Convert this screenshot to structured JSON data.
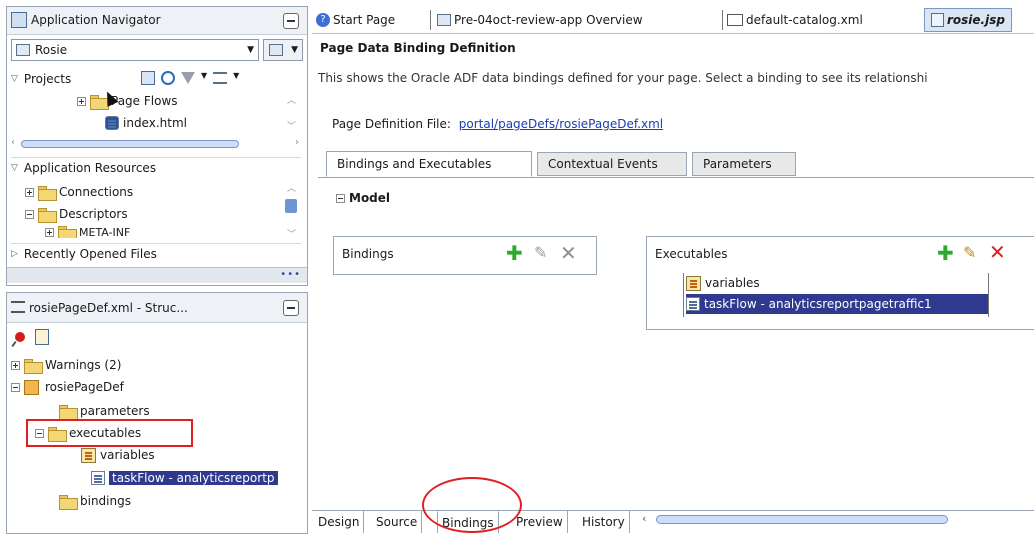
{
  "navigator": {
    "title": "Application Navigator",
    "app_name": "Rosie",
    "projects_label": "Projects",
    "project_items": [
      {
        "label": "Page Flows"
      },
      {
        "label": "index.html"
      }
    ],
    "app_resources_label": "Application Resources",
    "resource_items": [
      {
        "label": "Connections"
      },
      {
        "label": "Descriptors"
      },
      {
        "label": "META-INF"
      }
    ],
    "recent_files_label": "Recently Opened Files"
  },
  "structure": {
    "title": "rosiePageDef.xml - Struc...",
    "items": [
      {
        "label": "Warnings (2)"
      },
      {
        "label": "rosiePageDef"
      },
      {
        "label": "parameters"
      },
      {
        "label": "executables"
      },
      {
        "label": "variables"
      },
      {
        "label": "taskFlow - analyticsreportp"
      },
      {
        "label": "bindings"
      }
    ]
  },
  "editor_tabs": [
    {
      "label": "Start Page"
    },
    {
      "label": "Pre-04oct-review-app Overview"
    },
    {
      "label": "default-catalog.xml"
    },
    {
      "label": "rosie.jsp"
    }
  ],
  "page": {
    "heading": "Page Data Binding Definition",
    "description": "This shows the Oracle ADF data bindings defined for your page. Select a binding to see its relationshi",
    "pagedef_label": "Page Definition File:",
    "pagedef_link": "portal/pageDefs/rosiePageDef.xml",
    "subtabs": [
      {
        "label": "Bindings and Executables"
      },
      {
        "label": "Contextual Events"
      },
      {
        "label": "Parameters"
      }
    ],
    "model_label": "Model",
    "bindings_label": "Bindings",
    "executables_label": "Executables",
    "executables_items": [
      {
        "label": "variables"
      },
      {
        "label": "taskFlow - analyticsreportpagetraffic1"
      }
    ]
  },
  "bottom_tabs": [
    {
      "label": "Design"
    },
    {
      "label": "Source"
    },
    {
      "label": "Bindings"
    },
    {
      "label": "Preview"
    },
    {
      "label": "History"
    }
  ],
  "colors": {
    "selection": "#2f3a8e",
    "highlight_red": "#e02020",
    "link": "#1a3fb0"
  }
}
